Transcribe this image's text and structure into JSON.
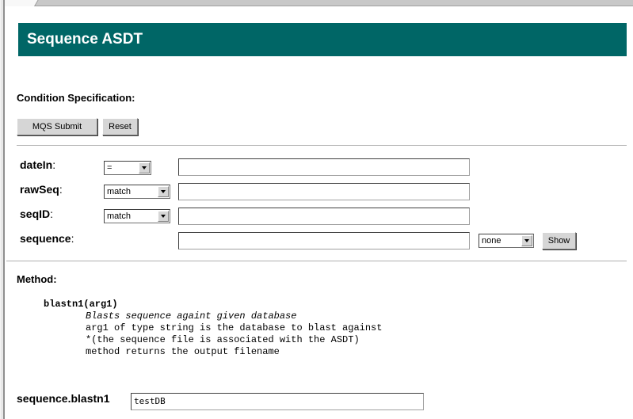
{
  "page": {
    "title": "Sequence ASDT"
  },
  "condition_spec": {
    "heading": "Condition Specification:",
    "submit_label": "MQS Submit",
    "reset_label": "Reset"
  },
  "fields": {
    "dateIn": {
      "label": "dateIn",
      "suffix": ":",
      "operator": "=",
      "value": ""
    },
    "rawSeq": {
      "label": "rawSeq",
      "suffix": ":",
      "operator": "match",
      "value": ""
    },
    "seqID": {
      "label": "seqID",
      "suffix": ":",
      "operator": "match",
      "value": ""
    },
    "sequence": {
      "label": "sequence",
      "suffix": ":",
      "value": "",
      "display_option": "none",
      "show_label": "Show"
    }
  },
  "method": {
    "heading": "Method:",
    "signature": "blastn1(arg1)",
    "description": "Blasts sequence againt given database",
    "lines": [
      "arg1 of type string is the database to blast against",
      "*(the sequence file is associated with the ASDT)",
      "method returns the output filename"
    ]
  },
  "method_input": {
    "label": "sequence.blastn1",
    "value": "testDB"
  }
}
